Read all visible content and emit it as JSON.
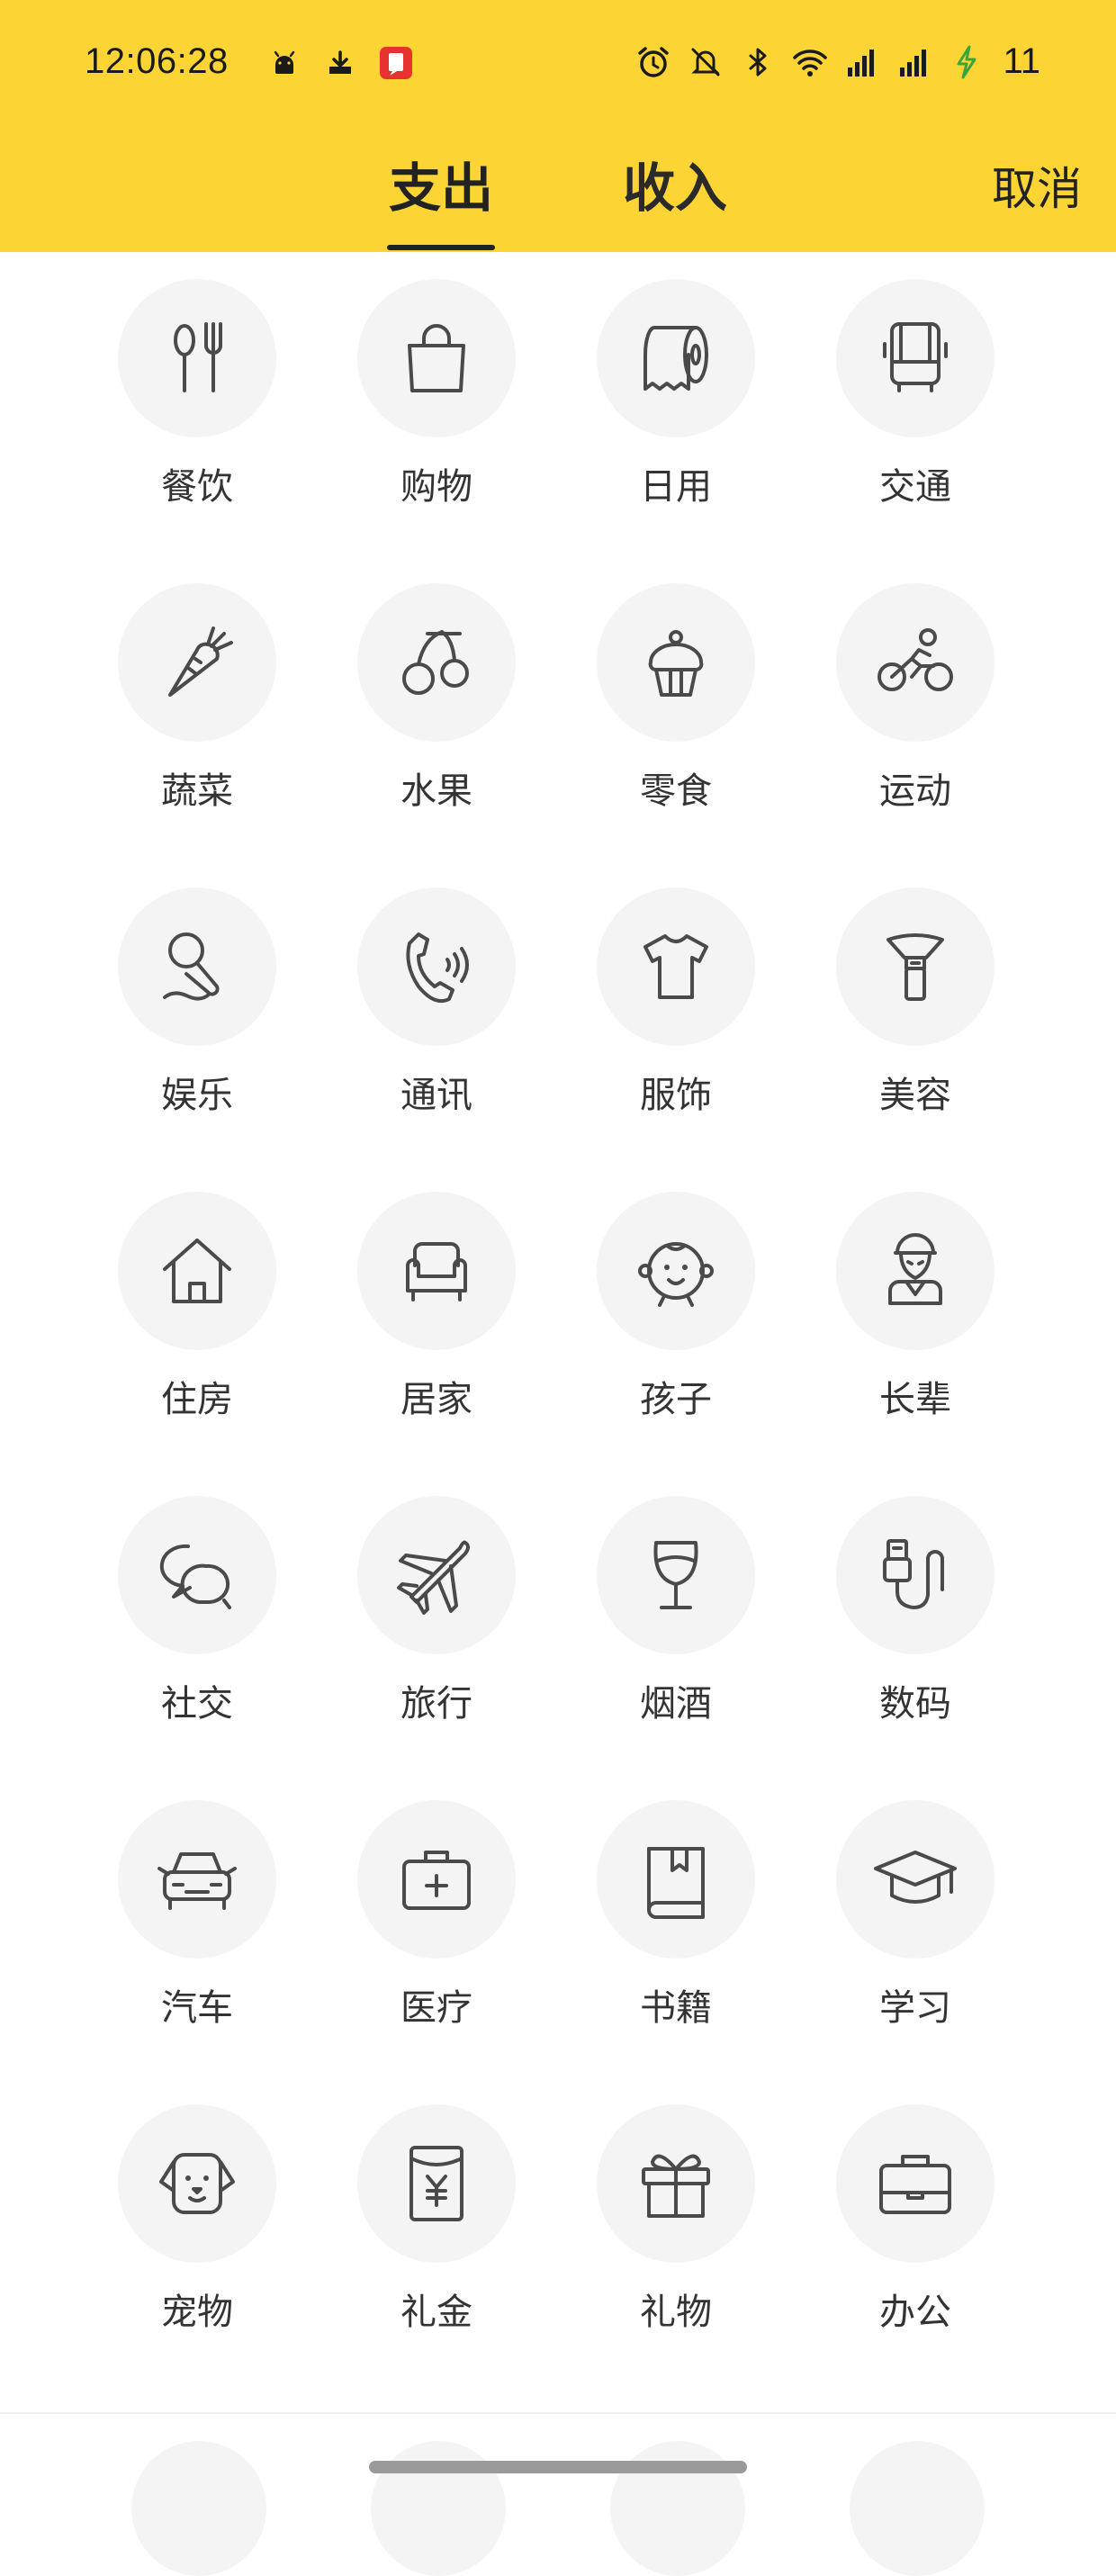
{
  "status_bar": {
    "time": "12:06:28",
    "battery_level": "11",
    "left_icons": [
      "android-icon",
      "download-icon",
      "app-notification-icon"
    ],
    "right_icons": [
      "alarm-icon",
      "mute-icon",
      "bluetooth-icon",
      "wifi-icon",
      "signal-icon",
      "signal-icon-2",
      "charging-icon"
    ]
  },
  "header": {
    "tabs": [
      {
        "label": "支出",
        "active": true
      },
      {
        "label": "收入",
        "active": false
      }
    ],
    "cancel_label": "取消",
    "background_color": "#fcd535"
  },
  "categories": [
    {
      "label": "餐饮",
      "icon": "utensils-icon"
    },
    {
      "label": "购物",
      "icon": "shopping-bag-icon"
    },
    {
      "label": "日用",
      "icon": "tissue-roll-icon"
    },
    {
      "label": "交通",
      "icon": "bus-icon"
    },
    {
      "label": "蔬菜",
      "icon": "carrot-icon"
    },
    {
      "label": "水果",
      "icon": "cherry-icon"
    },
    {
      "label": "零食",
      "icon": "cupcake-icon"
    },
    {
      "label": "运动",
      "icon": "cyclist-icon"
    },
    {
      "label": "娱乐",
      "icon": "microphone-icon"
    },
    {
      "label": "通讯",
      "icon": "phone-icon"
    },
    {
      "label": "服饰",
      "icon": "tshirt-icon"
    },
    {
      "label": "美容",
      "icon": "lipstick-icon"
    },
    {
      "label": "住房",
      "icon": "house-icon"
    },
    {
      "label": "居家",
      "icon": "armchair-icon"
    },
    {
      "label": "孩子",
      "icon": "baby-face-icon"
    },
    {
      "label": "长辈",
      "icon": "elder-icon"
    },
    {
      "label": "社交",
      "icon": "chat-bubbles-icon"
    },
    {
      "label": "旅行",
      "icon": "airplane-icon"
    },
    {
      "label": "烟酒",
      "icon": "wine-glass-icon"
    },
    {
      "label": "数码",
      "icon": "usb-cable-icon"
    },
    {
      "label": "汽车",
      "icon": "car-icon"
    },
    {
      "label": "医疗",
      "icon": "medical-kit-icon"
    },
    {
      "label": "书籍",
      "icon": "book-icon"
    },
    {
      "label": "学习",
      "icon": "graduation-cap-icon"
    },
    {
      "label": "宠物",
      "icon": "dog-face-icon"
    },
    {
      "label": "礼金",
      "icon": "red-envelope-icon"
    },
    {
      "label": "礼物",
      "icon": "gift-icon"
    },
    {
      "label": "办公",
      "icon": "briefcase-icon"
    }
  ]
}
